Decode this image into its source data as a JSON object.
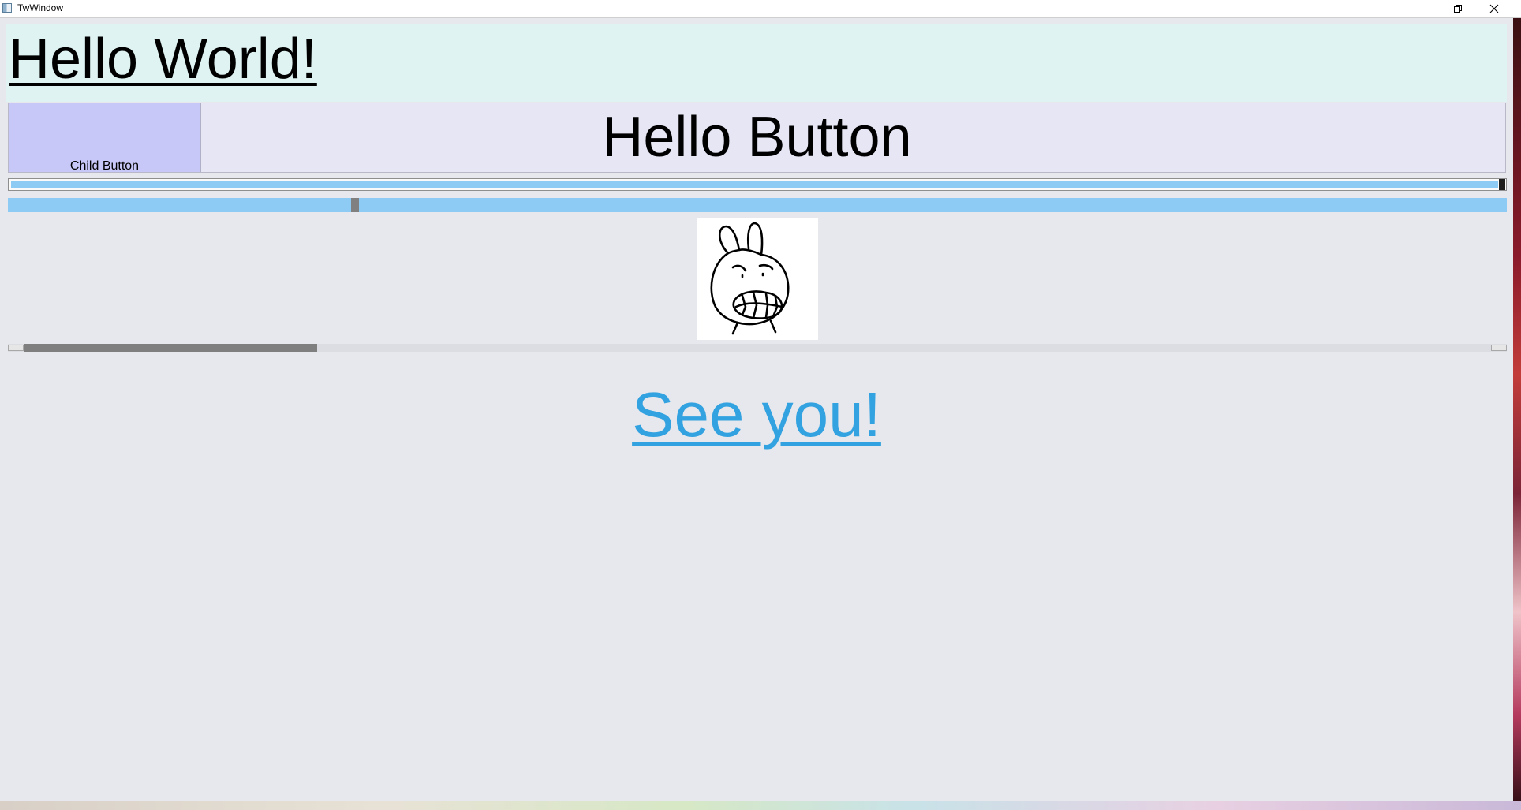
{
  "window": {
    "title": "TwWindow",
    "app_icon": "window-app-icon",
    "controls": {
      "minimize": "minimize-icon",
      "maximize": "restore-icon",
      "close": "close-icon"
    }
  },
  "content": {
    "hello_text": "Hello World!",
    "hello_button_label": "Hello Button",
    "child_button_label": "Child Button",
    "slider_top": {
      "value_fraction": 1.0
    },
    "slider_bottom": {
      "value_fraction": 0.23
    },
    "picture": {
      "subject": "bunny-face-sketch"
    },
    "hscroll": {
      "thumb_start_fraction": 0.0,
      "thumb_size_fraction": 0.2
    },
    "link_text": "See you!"
  },
  "colors": {
    "panel_bg": "#dff3f3",
    "button_bg": "#e6e6f5",
    "child_button_bg": "#c8c8f8",
    "slider_fill": "#8dcbf4",
    "link": "#33a2e0"
  }
}
